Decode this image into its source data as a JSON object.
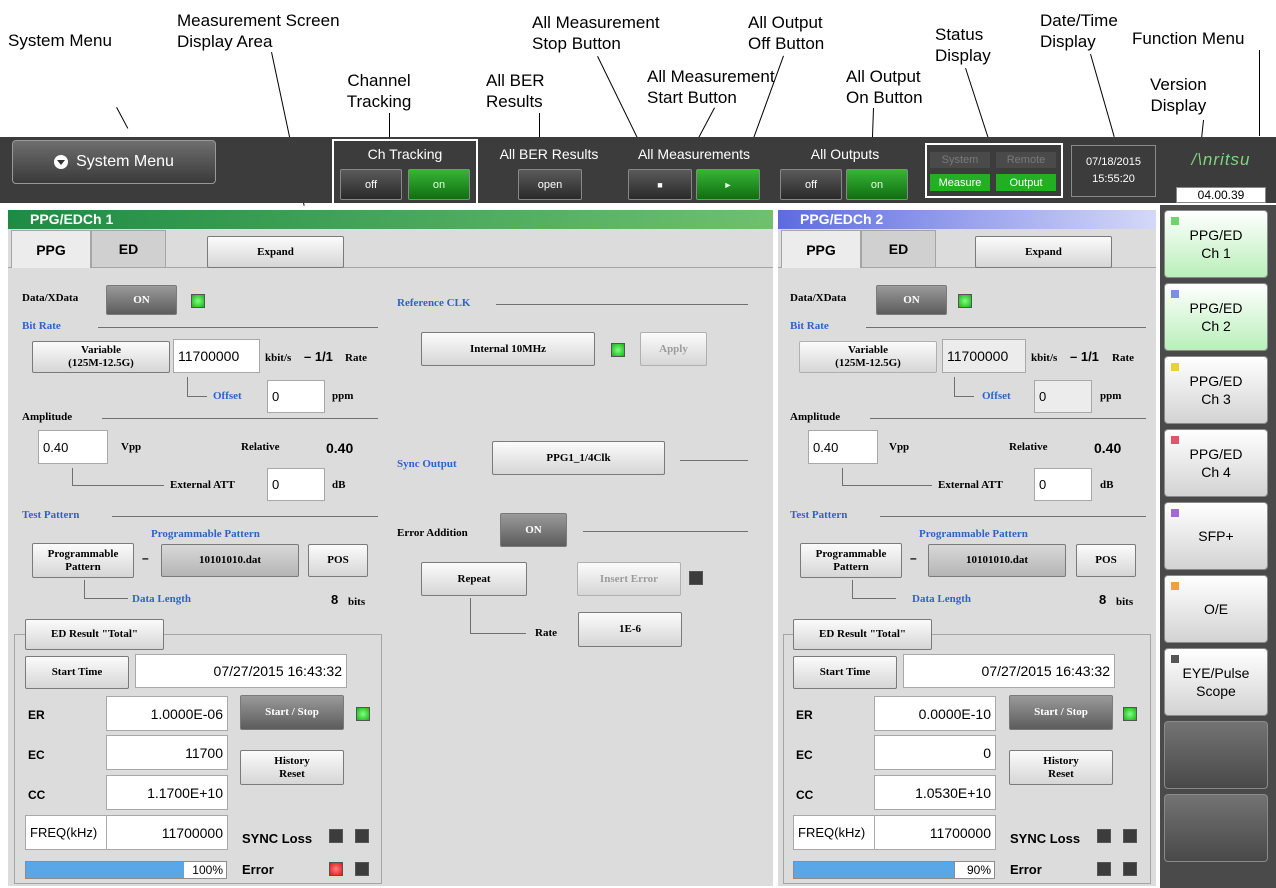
{
  "callouts": {
    "system_menu": "System Menu",
    "measurement_area": "Measurement Screen\nDisplay Area",
    "channel_tracking": "Channel\nTracking",
    "all_ber": "All BER\nResults",
    "all_stop": "All  Measurement\nStop Button",
    "all_start": "All Measurement\nStart Button",
    "all_off": "All    Output\nOff Button",
    "all_on": "All    Output\nOn Button",
    "status": "Status\nDisplay",
    "datetime": "Date/Time\nDisplay",
    "function_menu": "Function Menu",
    "version": "Version\nDisplay"
  },
  "topbar": {
    "system_menu": "System Menu",
    "ch_tracking": {
      "label": "Ch Tracking",
      "off": "off",
      "on": "on"
    },
    "all_ber": {
      "label": "All BER Results",
      "button": "open"
    },
    "all_measurements": {
      "label": "All Measurements",
      "stop_glyph": "■",
      "start_glyph": "►"
    },
    "all_outputs": {
      "label": "All Outputs",
      "off": "off",
      "on": "on"
    },
    "status": {
      "system": "System",
      "remote": "Remote",
      "measure": "Measure",
      "output": "Output"
    },
    "date": "07/18/2015",
    "time": "15:55:20",
    "logo": "/\\nritsu",
    "version": "04.00.39"
  },
  "ch1": {
    "title": "PPG/EDCh 1",
    "tab_ppg": "PPG",
    "tab_ed": "ED",
    "expand": "Expand",
    "data_xdata": "Data/XData",
    "data_on": "ON",
    "bit_rate": "Bit Rate",
    "variable": "Variable\n(125M-12.5G)",
    "bitrate_value": "11700000",
    "bitrate_unit": "kbit/s",
    "ratio": "– 1/1",
    "rate": "Rate",
    "offset": "Offset",
    "offset_value": "0",
    "ppm": "ppm",
    "amplitude": "Amplitude",
    "amp_value": "0.40",
    "vpp": "Vpp",
    "relative": "Relative",
    "relative_value": "0.40",
    "ext_att": "External ATT",
    "att_value": "0",
    "db": "dB",
    "test_pattern": "Test Pattern",
    "prog_pattern": "Programmable Pattern",
    "pattern_btn": "Programmable\nPattern",
    "dash": "–",
    "file": "10101010.dat",
    "pos": "POS",
    "data_length": "Data Length",
    "length_value": "8",
    "bits": "bits",
    "reference_clk": "Reference CLK",
    "internal": "Internal 10MHz",
    "apply": "Apply",
    "sync_output": "Sync Output",
    "sync_value": "PPG1_1/4Clk",
    "error_addition": "Error Addition",
    "error_on": "ON",
    "repeat": "Repeat",
    "insert_error": "Insert Error",
    "rate_label": "Rate",
    "rate_value": "1E-6",
    "ed_result": "ED Result \"Total\"",
    "start_time": "Start Time",
    "start_time_value": "07/27/2015 16:43:32",
    "er": "ER",
    "er_value": "1.0000E-06",
    "start_stop": "Start / Stop",
    "ec": "EC",
    "ec_value": "11700",
    "history_reset": "History\nReset",
    "cc": "CC",
    "cc_value": "1.1700E+10",
    "freq": "FREQ(kHz)",
    "freq_value": "11700000",
    "sync_loss": "SYNC Loss",
    "error": "Error",
    "progress": 1.0,
    "progress_text": "100%"
  },
  "ch2": {
    "title": "PPG/EDCh 2",
    "tab_ppg": "PPG",
    "tab_ed": "ED",
    "expand": "Expand",
    "data_xdata": "Data/XData",
    "data_on": "ON",
    "bit_rate": "Bit Rate",
    "variable": "Variable\n(125M-12.5G)",
    "bitrate_value": "11700000",
    "bitrate_unit": "kbit/s",
    "ratio": "– 1/1",
    "rate": "Rate",
    "offset": "Offset",
    "offset_value": "0",
    "ppm": "ppm",
    "amplitude": "Amplitude",
    "amp_value": "0.40",
    "vpp": "Vpp",
    "relative": "Relative",
    "relative_value": "0.40",
    "ext_att": "External ATT",
    "att_value": "0",
    "db": "dB",
    "test_pattern": "Test Pattern",
    "prog_pattern": "Programmable Pattern",
    "pattern_btn": "Programmable\nPattern",
    "dash": "–",
    "file": "10101010.dat",
    "pos": "POS",
    "data_length": "Data Length",
    "length_value": "8",
    "bits": "bits",
    "ed_result": "ED Result \"Total\"",
    "start_time": "Start Time",
    "start_time_value": "07/27/2015 16:43:32",
    "er": "ER",
    "er_value": "0.0000E-10",
    "start_stop": "Start / Stop",
    "ec": "EC",
    "ec_value": "0",
    "history_reset": "History\nReset",
    "cc": "CC",
    "cc_value": "1.0530E+10",
    "freq": "FREQ(kHz)",
    "freq_value": "11700000",
    "sync_loss": "SYNC Loss",
    "error": "Error",
    "progress": 0.9,
    "progress_text": "90%"
  },
  "function_menu": [
    {
      "label": "PPG/ED\nCh 1",
      "color": "#6fd36f",
      "selected": true
    },
    {
      "label": "PPG/ED\nCh 2",
      "color": "#7d8ee8",
      "selected": true
    },
    {
      "label": "PPG/ED\nCh 3",
      "color": "#e7d23a",
      "selected": false
    },
    {
      "label": "PPG/ED\nCh 4",
      "color": "#e0556a",
      "selected": false
    },
    {
      "label": "SFP+",
      "color": "#a56ad0",
      "selected": false
    },
    {
      "label": "O/E",
      "color": "#efa23c",
      "selected": false
    },
    {
      "label": "EYE/Pulse\nScope",
      "color": "#555555",
      "selected": false
    },
    {
      "label": "",
      "color": "",
      "selected": false
    },
    {
      "label": "",
      "color": "",
      "selected": false
    }
  ]
}
